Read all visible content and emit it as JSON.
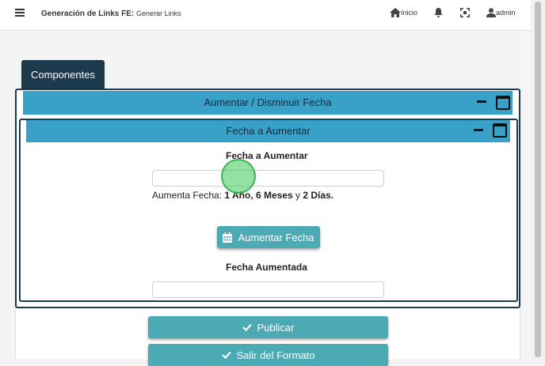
{
  "header": {
    "title_bold": "Generación de Links FE:",
    "title_sub": "Generar Links",
    "nav": {
      "inicio_label": "Inicio",
      "user_label": "admin"
    }
  },
  "tabs": {
    "componentes_label": "Componentes"
  },
  "outer_section": {
    "title": "Aumentar / Disminuir Fecha"
  },
  "inner_section": {
    "title": "Fecha a Aumentar",
    "fecha_aumentar_label": "Fecha a Aumentar",
    "fecha_aumentar_value": "",
    "info_prefix": "Aumenta Fecha: ",
    "info_years": "1 Año, 6 Meses",
    "info_sep": " y ",
    "info_days": "2 Días.",
    "aumentar_button_label": "Aumentar Fecha",
    "fecha_aumentada_label": "Fecha Aumentada",
    "fecha_aumentada_value": ""
  },
  "actions": {
    "publicar_label": "Publicar",
    "salir_label": "Salir del Formato"
  },
  "colors": {
    "header_blue": "#39a0c8",
    "dark_navy": "#1b3a4e",
    "button_teal": "#4caab5"
  },
  "icons": [
    "menu-icon",
    "home-icon",
    "bell-icon",
    "expand-icon",
    "user-icon",
    "minus-icon",
    "window-icon",
    "calendar-icon",
    "check-icon"
  ]
}
